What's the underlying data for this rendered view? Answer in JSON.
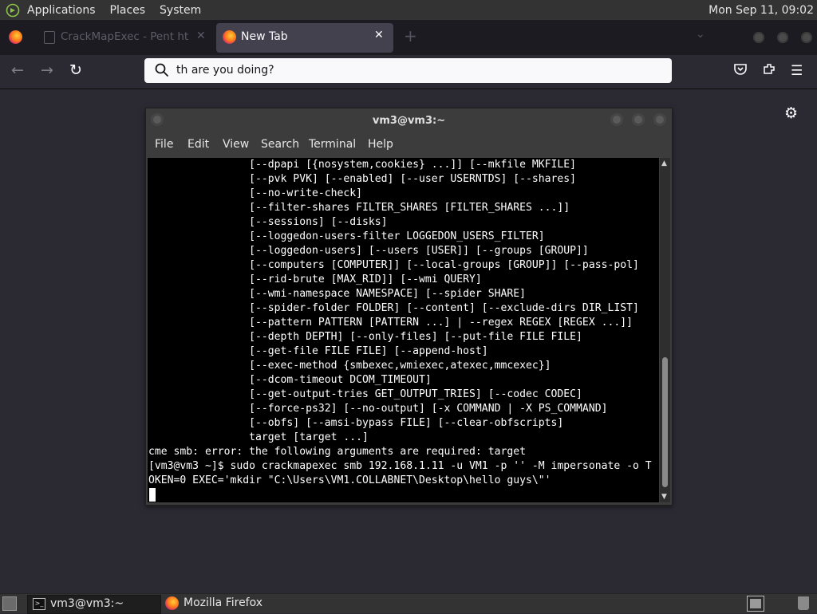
{
  "top_panel": {
    "menus": [
      "Applications",
      "Places",
      "System"
    ],
    "clock": "Mon Sep 11, 09:02"
  },
  "browser": {
    "tabs": [
      {
        "title": "CrackMapExec - Pent ht",
        "active": false
      },
      {
        "title": "New Tab",
        "active": true
      }
    ],
    "url_value": "th are you doing?"
  },
  "terminal": {
    "title": "vm3@vm3:~",
    "menus": [
      "File",
      "Edit",
      "View",
      "Search",
      "Terminal",
      "Help"
    ],
    "lines": [
      "                [--dpapi [{nosystem,cookies} ...]] [--mkfile MKFILE]",
      "                [--pvk PVK] [--enabled] [--user USERNTDS] [--shares]",
      "                [--no-write-check]",
      "                [--filter-shares FILTER_SHARES [FILTER_SHARES ...]]",
      "                [--sessions] [--disks]",
      "                [--loggedon-users-filter LOGGEDON_USERS_FILTER]",
      "                [--loggedon-users] [--users [USER]] [--groups [GROUP]]",
      "                [--computers [COMPUTER]] [--local-groups [GROUP]] [--pass-pol]",
      "                [--rid-brute [MAX_RID]] [--wmi QUERY]",
      "                [--wmi-namespace NAMESPACE] [--spider SHARE]",
      "                [--spider-folder FOLDER] [--content] [--exclude-dirs DIR_LIST]",
      "                [--pattern PATTERN [PATTERN ...] | --regex REGEX [REGEX ...]]",
      "                [--depth DEPTH] [--only-files] [--put-file FILE FILE]",
      "                [--get-file FILE FILE] [--append-host]",
      "                [--exec-method {smbexec,wmiexec,atexec,mmcexec}]",
      "                [--dcom-timeout DCOM_TIMEOUT]",
      "                [--get-output-tries GET_OUTPUT_TRIES] [--codec CODEC]",
      "                [--force-ps32] [--no-output] [-x COMMAND | -X PS_COMMAND]",
      "                [--obfs] [--amsi-bypass FILE] [--clear-obfscripts]",
      "                target [target ...]",
      "cme smb: error: the following arguments are required: target",
      "[vm3@vm3 ~]$ sudo crackmapexec smb 192.168.1.11 -u VM1 -p '' -M impersonate -o T",
      "OKEN=0 EXEC='mkdir \"C:\\Users\\VM1.COLLABNET\\Desktop\\hello guys\\\"'"
    ]
  },
  "taskbar": {
    "tasks": [
      {
        "label": "vm3@vm3:~"
      },
      {
        "label": "Mozilla Firefox"
      }
    ]
  }
}
